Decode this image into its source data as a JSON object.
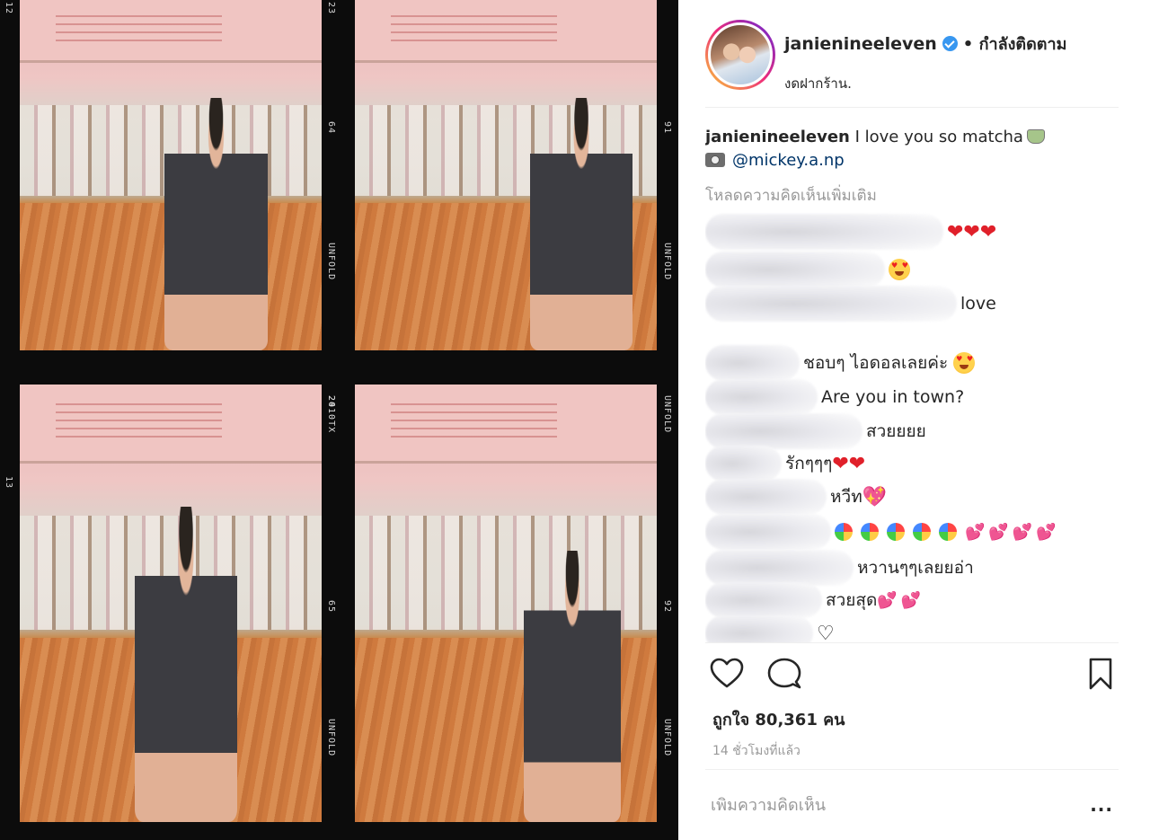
{
  "post": {
    "author": "janienineeleven",
    "follow_status": "• กำลังติดตาม",
    "location": "งดฝากร้าน.",
    "caption": {
      "author": "janienineeleven",
      "text": "I love you so matcha",
      "photo_credit": "@mickey.a.np"
    },
    "load_more": "โหลดความคิดเห็นเพิ่มเติม",
    "comments": [
      {
        "text": ""
      },
      {
        "text": ""
      },
      {
        "text": "love"
      },
      {
        "text": "ชอบๆ ไอดอลเลยค่ะ"
      },
      {
        "text": "Are you in town?"
      },
      {
        "text": "สวยยยย"
      },
      {
        "text": "รักๆๆๆ"
      },
      {
        "text": "หวีท"
      },
      {
        "text": ""
      },
      {
        "text": "หวานๆๆเลยยอ่า"
      },
      {
        "text": "สวยสุด"
      },
      {
        "text": "♡"
      }
    ],
    "likes": "ถูกใจ 80,361 คน",
    "time": "14 ชั่วโมงที่แล้ว",
    "add_comment_placeholder": "เพิ่มความคิดเห็น",
    "more_label": "..."
  },
  "film": {
    "edge_labels": [
      "UNFOLD",
      "2010TX",
      "23",
      "24",
      "13",
      "64",
      "91",
      "65",
      "92",
      "12"
    ]
  },
  "icons": {
    "verified": "verified-badge-icon",
    "camera": "camera-icon",
    "matcha": "matcha-icon",
    "like": "heart-outline-icon",
    "comment": "comment-bubble-icon",
    "save": "bookmark-icon",
    "heart_color": "#e0202a",
    "accent": "#3897f0"
  }
}
